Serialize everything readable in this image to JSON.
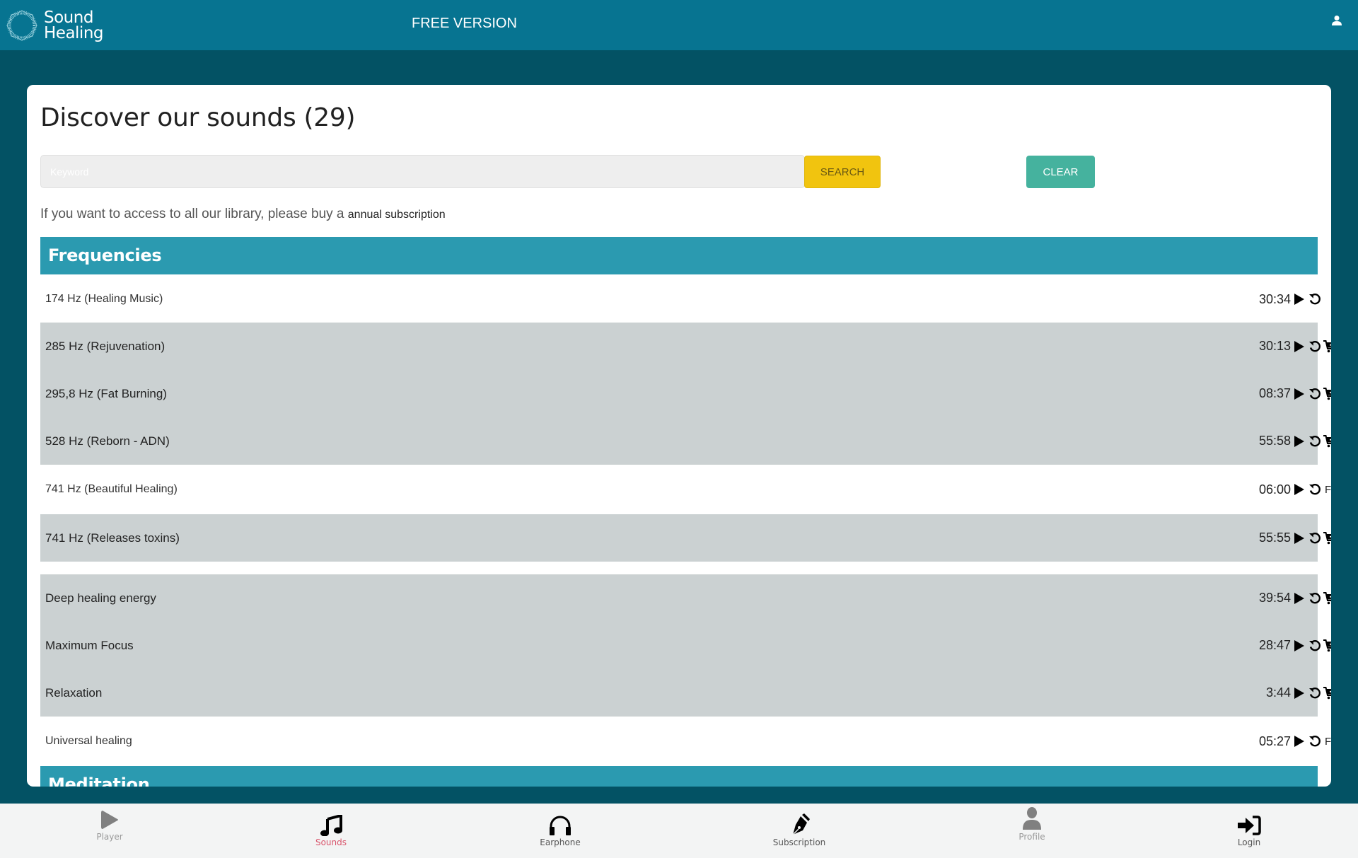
{
  "header": {
    "logo_line1": "Sound",
    "logo_line2": "Healing",
    "version_label": "FREE VERSION",
    "user_icon": "user-icon"
  },
  "main": {
    "title": "Discover our sounds (29)",
    "search": {
      "placeholder": "Keyword",
      "value": "",
      "search_label": "SEARCH",
      "clear_label": "CLEAR"
    },
    "notice": {
      "text": "If you want to access to all our library, please buy a ",
      "link": "annual subscription"
    },
    "sections": [
      {
        "title": "Frequencies",
        "items": [
          {
            "name": "174 Hz (Healing Music)",
            "duration": "30:34",
            "status": "owned"
          },
          {
            "name": "285 Hz (Rejuvenation)",
            "duration": "30:13",
            "status": "buy"
          },
          {
            "name": "295,8 Hz (Fat Burning)",
            "duration": "08:37",
            "status": "buy"
          },
          {
            "name": "528 Hz (Reborn - ADN)",
            "duration": "55:58",
            "status": "buy"
          },
          {
            "name": "741 Hz (Beautiful Healing)",
            "duration": "06:00",
            "status": "free"
          },
          {
            "name": "741 Hz (Releases toxins)",
            "duration": "55:55",
            "status": "buy"
          },
          {
            "name": "Deep healing energy",
            "duration": "39:54",
            "status": "buy"
          },
          {
            "name": "Maximum Focus",
            "duration": "28:47",
            "status": "buy"
          },
          {
            "name": "Relaxation",
            "duration": "3:44",
            "status": "buy"
          },
          {
            "name": "Universal healing",
            "duration": "05:27",
            "status": "free"
          }
        ]
      },
      {
        "title": "Meditation",
        "items": []
      }
    ],
    "free_label": "FREE"
  },
  "bottom_nav": [
    {
      "label": "Player",
      "icon": "play-icon",
      "state": "disabled"
    },
    {
      "label": "Sounds",
      "icon": "music-note-icon",
      "state": "active"
    },
    {
      "label": "Earphone",
      "icon": "headphones-icon",
      "state": "normal"
    },
    {
      "label": "Subscription",
      "icon": "pen-nib-icon",
      "state": "normal"
    },
    {
      "label": "Profile",
      "icon": "user-icon",
      "state": "disabled"
    },
    {
      "label": "Login",
      "icon": "sign-in-icon",
      "state": "normal"
    }
  ],
  "colors": {
    "header_bg": "#077491",
    "page_bg": "#035264",
    "section_bg": "#2b9ab0",
    "row_grey": "#cbd1d2",
    "search_btn": "#f1c40f",
    "clear_btn": "#45b29e",
    "nav_active": "#d9546b"
  }
}
